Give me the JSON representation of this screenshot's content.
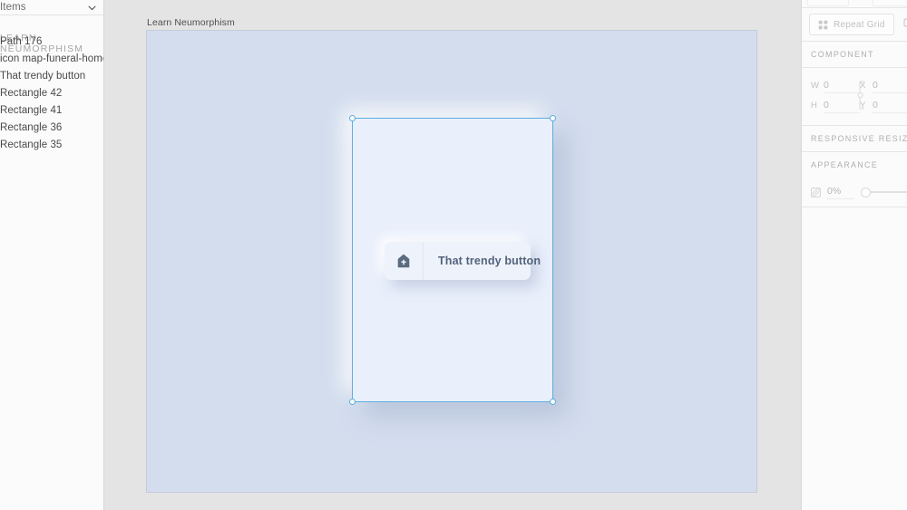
{
  "layers_panel": {
    "header_label": "Items",
    "chevron_icon": "chevron-down-icon",
    "group_label": "LEARN NEUMORPHISM",
    "items": [
      {
        "label": "Path 176"
      },
      {
        "label": "icon map-funeral-home"
      },
      {
        "label": "That trendy button"
      },
      {
        "label": "Rectangle 42"
      },
      {
        "label": "Rectangle 41"
      },
      {
        "label": "Rectangle 36"
      },
      {
        "label": "Rectangle 35"
      }
    ]
  },
  "canvas": {
    "artboard_label": "Learn Neumorphism",
    "artboard_color": "#d3ddee",
    "card_color": "#e9effb",
    "selection_color": "#5aaee0",
    "button": {
      "label": "That trendy button",
      "icon": "funeral-home-icon",
      "background": "#eef2fb",
      "text_color": "#52637c"
    }
  },
  "properties_panel": {
    "repeat_grid": {
      "label": "Repeat Grid",
      "icon": "grid-icon"
    },
    "duplicate_icon": "duplicate-icon",
    "sections": [
      {
        "title": "COMPONENT"
      },
      {
        "title": "RESPONSIVE RESIZE"
      },
      {
        "title": "APPEARANCE"
      }
    ],
    "dimensions": {
      "w_label": "W",
      "w_value": "0",
      "x_label": "X",
      "x_value": "0",
      "h_label": "H",
      "h_value": "0",
      "y_label": "Y",
      "y_value": "0",
      "lock_icon": "link-lock-icon"
    },
    "appearance": {
      "opacity_icon": "opacity-icon",
      "opacity_value": "0%",
      "slider_position": 0
    }
  }
}
